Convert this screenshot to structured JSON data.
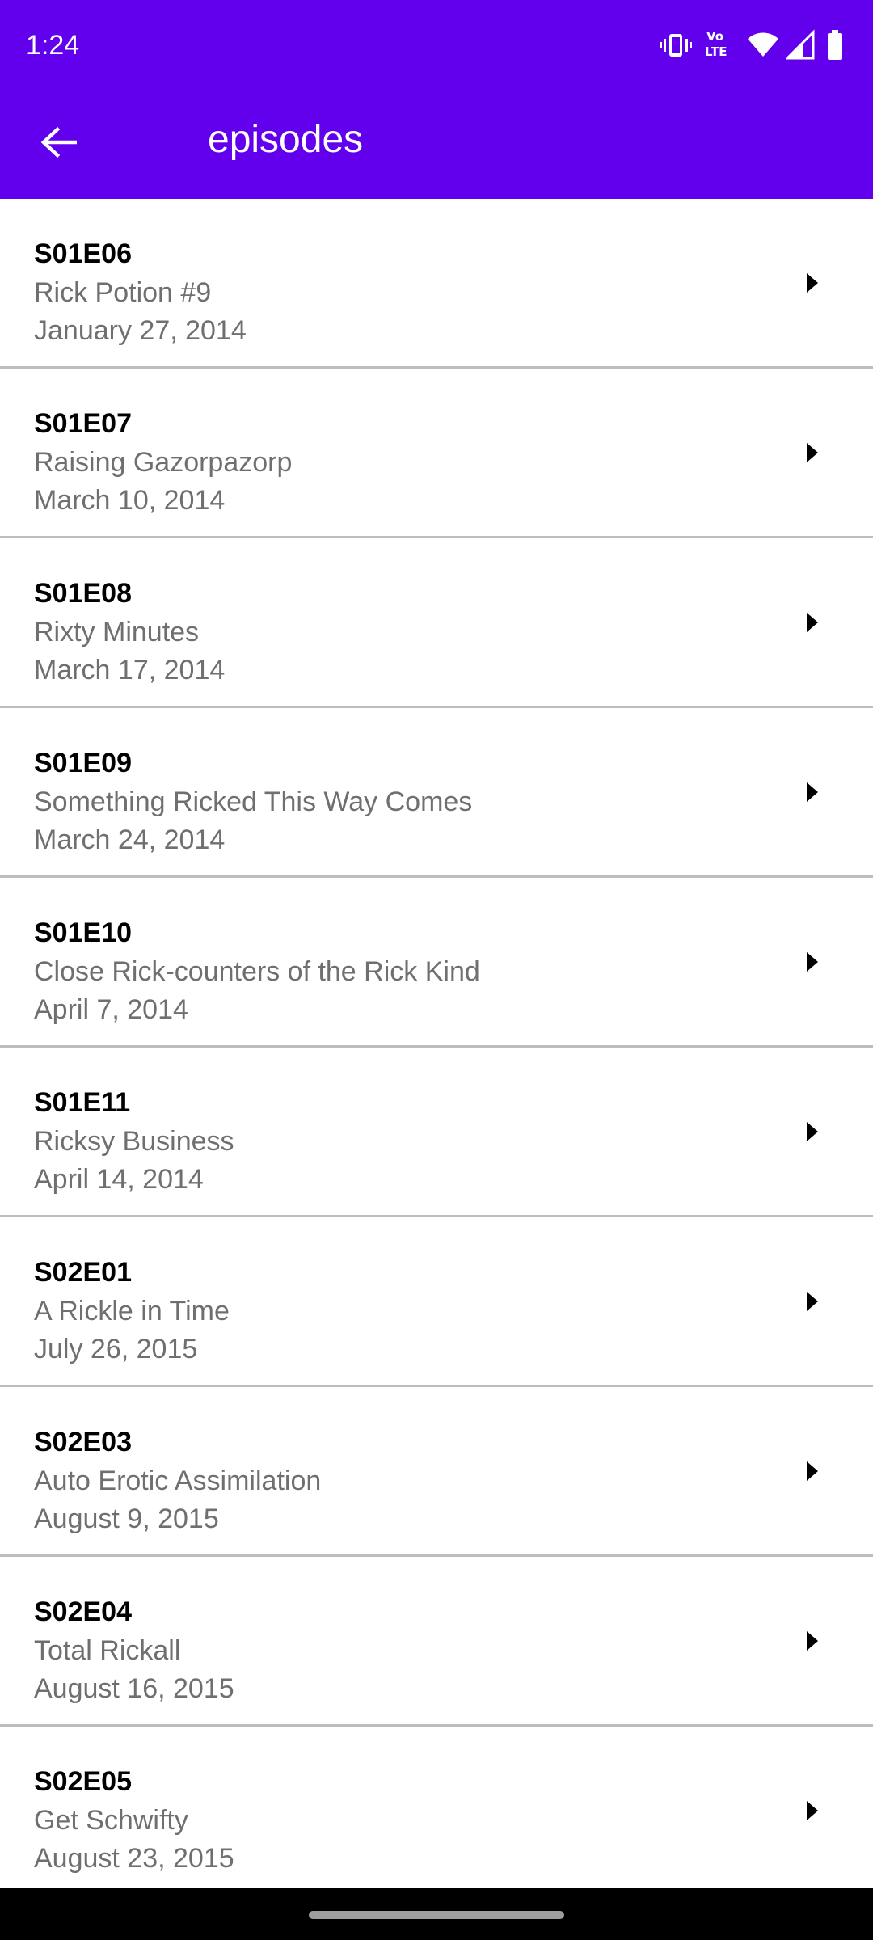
{
  "theme": {
    "accent": "#6200ee",
    "divider": "#bdbdbd",
    "secondary_text": "#6f6f6f"
  },
  "status_bar": {
    "time": "1:24",
    "icons": [
      "vibrate-icon",
      "volte-icon",
      "wifi-icon",
      "cell-signal-icon",
      "battery-icon"
    ],
    "volte_top": "Vo",
    "volte_bottom": "LTE"
  },
  "toolbar": {
    "back_icon": "arrow-back-icon",
    "title": "episodes"
  },
  "episodes": [
    {
      "code": "S01E06",
      "title": "Rick Potion #9",
      "date": "January 27, 2014"
    },
    {
      "code": "S01E07",
      "title": "Raising Gazorpazorp",
      "date": "March 10, 2014"
    },
    {
      "code": "S01E08",
      "title": "Rixty Minutes",
      "date": "March 17, 2014"
    },
    {
      "code": "S01E09",
      "title": "Something Ricked This Way Comes",
      "date": "March 24, 2014"
    },
    {
      "code": "S01E10",
      "title": "Close Rick-counters of the Rick Kind",
      "date": "April 7, 2014"
    },
    {
      "code": "S01E11",
      "title": "Ricksy Business",
      "date": "April 14, 2014"
    },
    {
      "code": "S02E01",
      "title": "A Rickle in Time",
      "date": "July 26, 2015"
    },
    {
      "code": "S02E03",
      "title": "Auto Erotic Assimilation",
      "date": "August 9, 2015"
    },
    {
      "code": "S02E04",
      "title": "Total Rickall",
      "date": "August 16, 2015"
    },
    {
      "code": "S02E05",
      "title": "Get Schwifty",
      "date": "August 23, 2015"
    }
  ],
  "row_icon": "chevron-right-icon",
  "nav_bar": {
    "handle": "gesture-handle"
  }
}
